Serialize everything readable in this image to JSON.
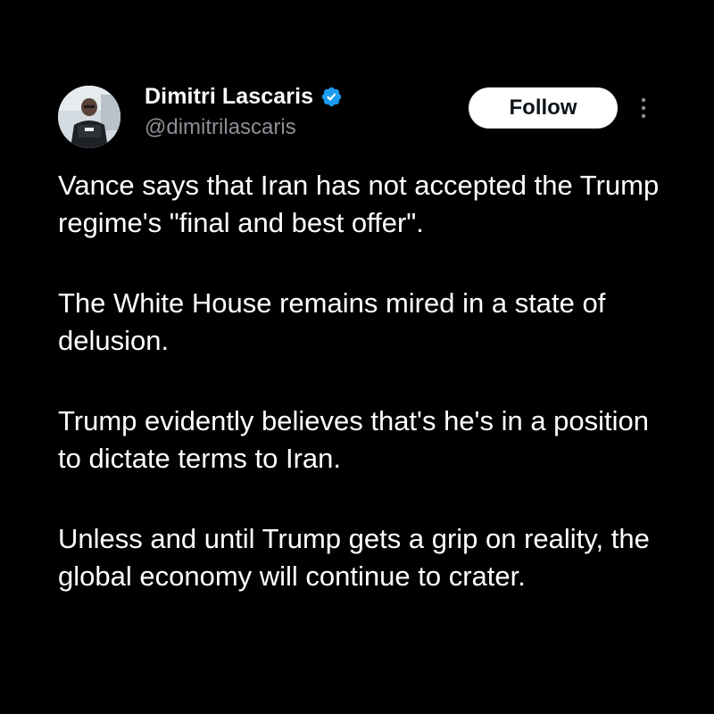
{
  "author": {
    "display_name": "Dimitri Lascaris",
    "handle": "@dimitrilascaris",
    "verified": true,
    "verified_icon": "verified-badge-icon",
    "avatar_icon": "profile-photo"
  },
  "actions": {
    "follow_label": "Follow",
    "more_icon": "more-vertical-icon"
  },
  "tweet": {
    "paragraphs": [
      "Vance says that Iran has not accepted the Trump regime's \"final and best offer\".",
      "The White House remains mired in a state of delusion.",
      "Trump evidently believes that's he's in a position to dictate terms to Iran.",
      "Unless and until Trump gets a grip on reality, the global economy will continue to crater."
    ]
  },
  "colors": {
    "background": "#000000",
    "text_primary": "#ffffff",
    "text_secondary": "#8b9096",
    "verified_blue": "#1d9bf0",
    "follow_bg": "#ffffff",
    "follow_text": "#0f1419"
  }
}
